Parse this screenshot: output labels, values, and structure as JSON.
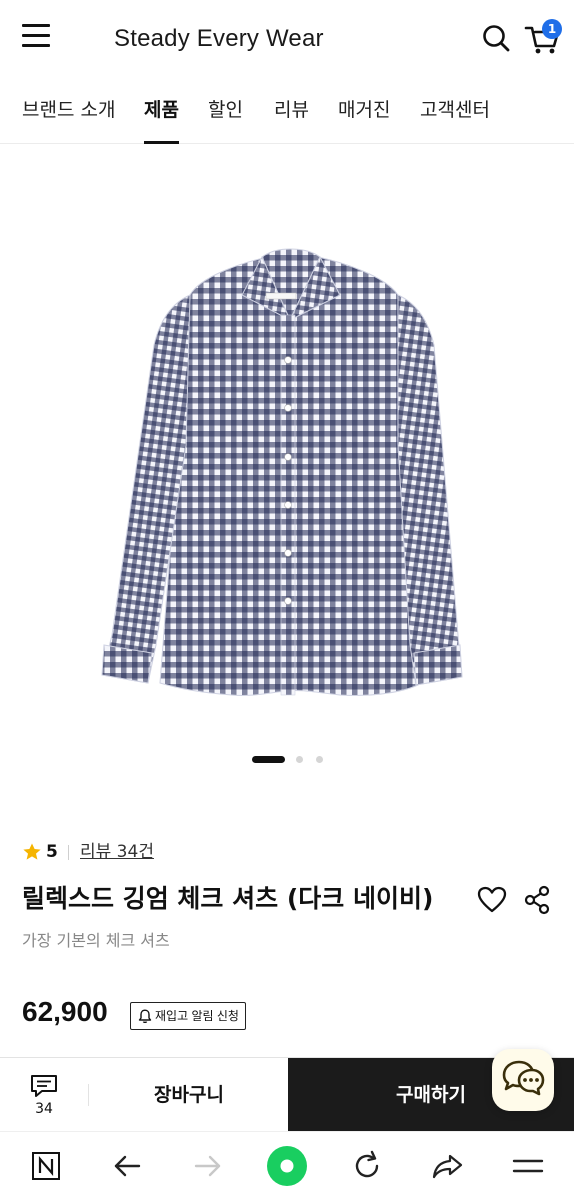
{
  "header": {
    "brand": "Steady Every Wear",
    "cart_count": "1"
  },
  "category_nav": {
    "tabs": [
      {
        "label": "브랜드 소개",
        "active": false
      },
      {
        "label": "제품",
        "active": true
      },
      {
        "label": "할인",
        "active": false
      },
      {
        "label": "리뷰",
        "active": false
      },
      {
        "label": "매거진",
        "active": false
      },
      {
        "label": "고객센터",
        "active": false
      }
    ]
  },
  "gallery": {
    "image": "navy-gingham-check-shirt",
    "slide_count": 3,
    "active_slide": 1
  },
  "product": {
    "rating": "5",
    "review_link": "리뷰 34건",
    "title": "릴렉스드 깅엄 체크 셔츠 (다크 네이비)",
    "subtitle": "가장 기본의 체크 셔츠",
    "price": "62,900",
    "restock_button": "재입고 알림 신청"
  },
  "purchase_bar": {
    "qna_count": "34",
    "cart_button": "장바구니",
    "buy_button": "구매하기"
  },
  "browser_bar": {
    "icons": [
      "naver-home-icon",
      "back-arrow-icon",
      "forward-arrow-icon",
      "green-dot-icon",
      "refresh-icon",
      "share-arrow-icon",
      "menu-icon"
    ]
  },
  "colors": {
    "accent_blue": "#1f6ee8",
    "buy_button_bg": "#1b1b1b",
    "star": "#f5b400",
    "green_dot": "#19ce60",
    "shirt_navy": "#1f2752"
  }
}
